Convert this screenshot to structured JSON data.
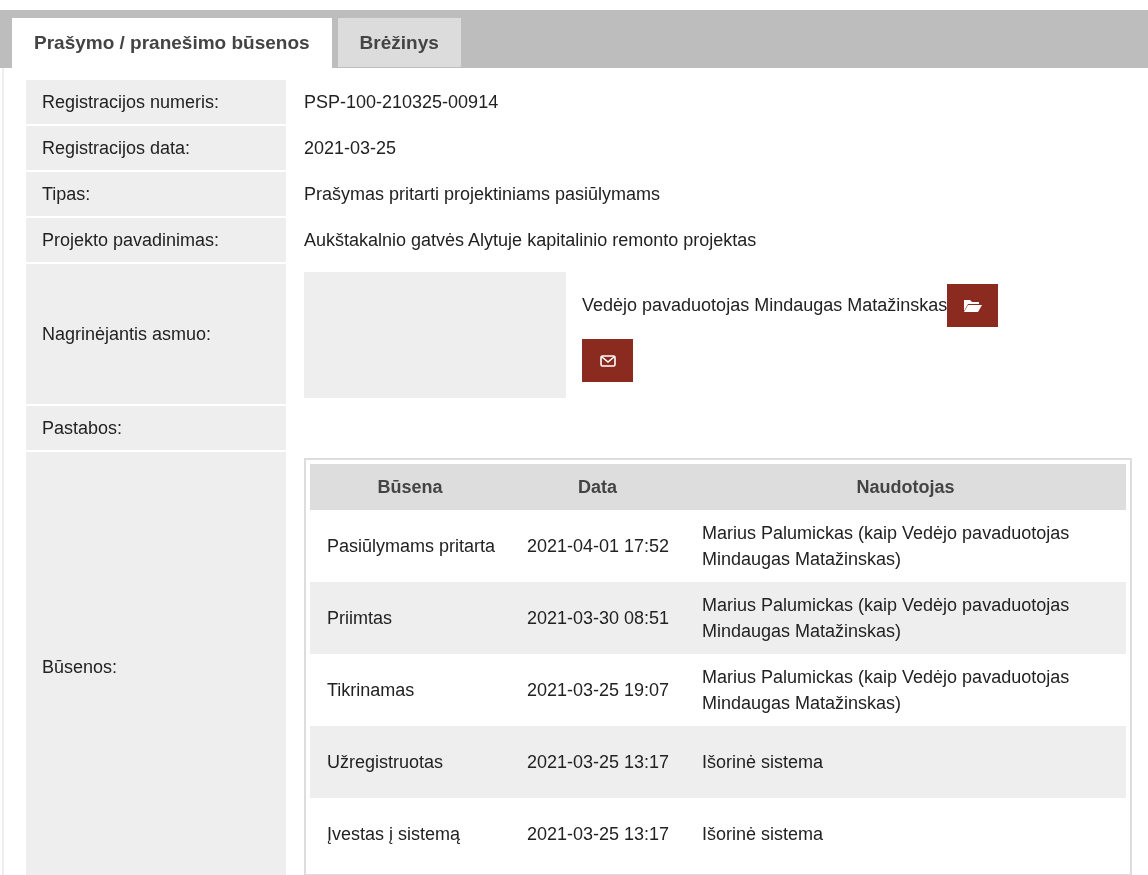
{
  "tabs": [
    {
      "label": "Prašymo / pranešimo būsenos",
      "selected": true
    },
    {
      "label": "Brėžinys",
      "selected": false
    }
  ],
  "fields": [
    {
      "kind": "text",
      "label": "Registracijos numeris:",
      "value": "PSP-100-210325-00914"
    },
    {
      "kind": "text",
      "label": "Registracijos data:",
      "value": "2021-03-25"
    },
    {
      "kind": "text",
      "label": "Tipas:",
      "value": "Prašymas pritarti projektiniams pasiūlymams"
    },
    {
      "kind": "text",
      "label": "Projekto pavadinimas:",
      "value": "Aukštakalnio gatvės Alytuje kapitalinio remonto projektas"
    },
    {
      "kind": "person",
      "label": "Nagrinėjantis asmuo:",
      "value": "Vedėjo pavaduotojas Mindaugas Matažinskas"
    },
    {
      "kind": "text",
      "label": "Pastabos:"
    },
    {
      "kind": "table",
      "label": "Būsenos:"
    }
  ],
  "status_table": {
    "columns": [
      "Būsena",
      "Data",
      "Naudotojas"
    ],
    "rows": [
      [
        "Pasiūlymams pritarta",
        "2021-04-01 17:52",
        "Marius Palumickas (kaip Vedėjo pavaduotojas Mindaugas Matažinskas)"
      ],
      [
        "Priimtas",
        "2021-03-30 08:51",
        "Marius Palumickas (kaip Vedėjo pavaduotojas Mindaugas Matažinskas)"
      ],
      [
        "Tikrinamas",
        "2021-03-25 19:07",
        "Marius Palumickas (kaip Vedėjo pavaduotojas Mindaugas Matažinskas)"
      ],
      [
        "Užregistruotas",
        "2021-03-25 13:17",
        "Išorinė sistema"
      ],
      [
        "Įvestas į sistemą",
        "2021-03-25 13:17",
        "Išorinė sistema"
      ]
    ]
  }
}
